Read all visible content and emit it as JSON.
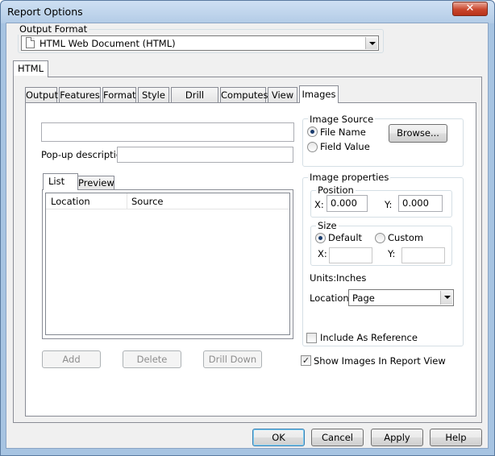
{
  "window": {
    "title": "Report Options",
    "close_symbol": "✕"
  },
  "output_format": {
    "label": "Output Format",
    "selected": "HTML Web Document (HTML)"
  },
  "outer_tab": "HTML",
  "tabs": [
    "Output",
    "Features",
    "Format",
    "Style",
    "Drill Down",
    "Computes",
    "View",
    "Images"
  ],
  "active_tab": "Images",
  "left": {
    "image_name_value": "",
    "popup_label": "Pop-up description:",
    "popup_value": "",
    "list_tabs": [
      "List",
      "Preview"
    ],
    "columns": [
      "Location",
      "Source"
    ],
    "buttons": {
      "add": "Add",
      "delete": "Delete",
      "drill_down": "Drill Down"
    }
  },
  "image_source": {
    "label": "Image Source",
    "file_name": "File Name",
    "field_value": "Field Value",
    "browse": "Browse..."
  },
  "image_properties": {
    "label": "Image properties",
    "position_label": "Position",
    "x_label": "X:",
    "y_label": "Y:",
    "x_value": "0.000",
    "y_value": "0.000",
    "size_label": "Size",
    "default_label": "Default",
    "custom_label": "Custom",
    "size_x_label": "X:",
    "size_y_label": "Y:",
    "units_label": "Units:",
    "units_value": "Inches",
    "location_label": "Location:",
    "location_value": "Page",
    "include_ref": "Include As Reference"
  },
  "show_images": "Show Images In Report View",
  "footer": {
    "ok": "OK",
    "cancel": "Cancel",
    "apply": "Apply",
    "help": "Help"
  }
}
